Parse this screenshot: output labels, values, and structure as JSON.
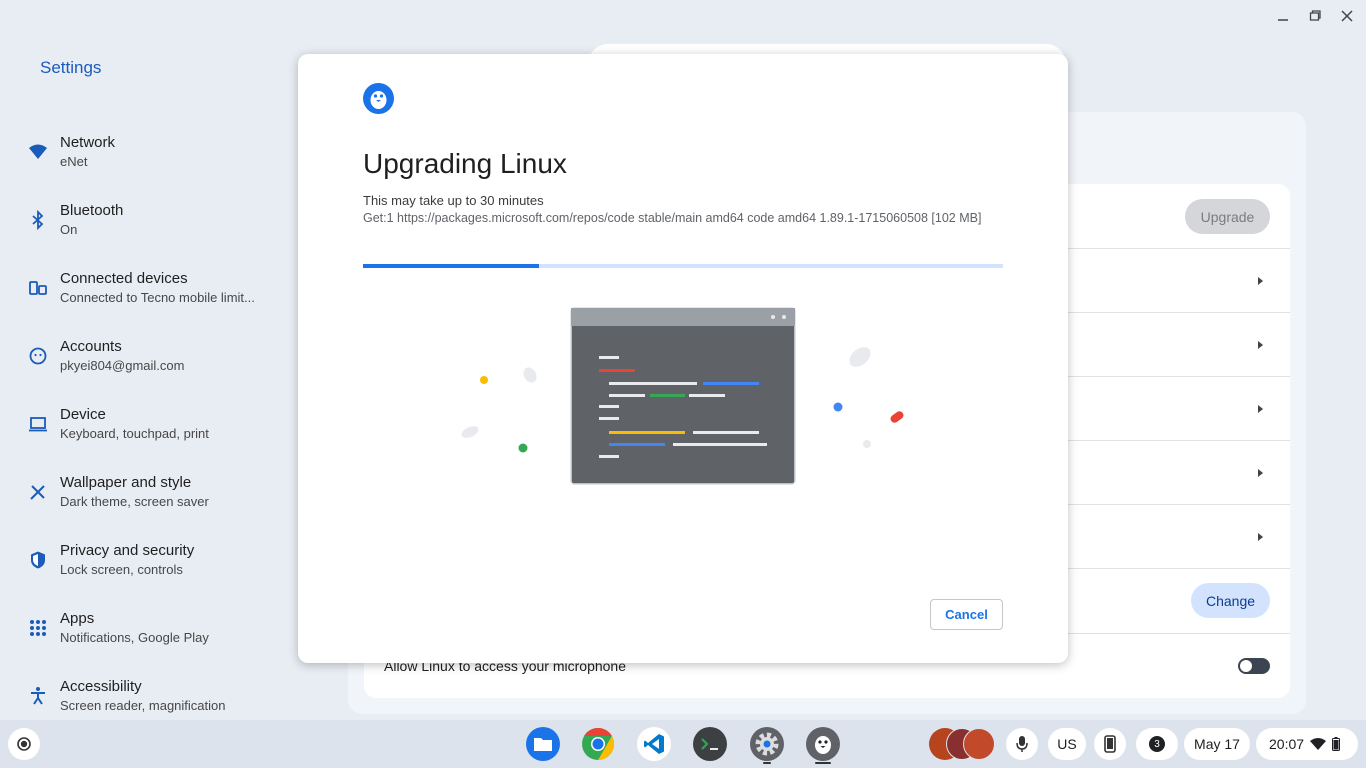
{
  "window": {
    "controls": [
      "minimize-icon",
      "restore-icon",
      "close-icon"
    ]
  },
  "settings": {
    "title": "Settings",
    "nav": [
      {
        "label": "Network",
        "sub": "eNet",
        "icon": "wifi-icon"
      },
      {
        "label": "Bluetooth",
        "sub": "On",
        "icon": "bluetooth-icon"
      },
      {
        "label": "Connected devices",
        "sub": "Connected to Tecno mobile limit...",
        "icon": "connected-devices-icon"
      },
      {
        "label": "Accounts",
        "sub": "pkyei804@gmail.com",
        "icon": "account-icon"
      },
      {
        "label": "Device",
        "sub": "Keyboard, touchpad, print",
        "icon": "laptop-icon"
      },
      {
        "label": "Wallpaper and style",
        "sub": "Dark theme, screen saver",
        "icon": "brush-icon"
      },
      {
        "label": "Privacy and security",
        "sub": "Lock screen, controls",
        "icon": "shield-icon"
      },
      {
        "label": "Apps",
        "sub": "Notifications, Google Play",
        "icon": "apps-grid-icon"
      },
      {
        "label": "Accessibility",
        "sub": "Screen reader, magnification",
        "icon": "accessibility-icon"
      }
    ]
  },
  "main": {
    "upgrade_label": "Upgrade",
    "change_label": "Change",
    "microphone_label": "Allow Linux to access your microphone",
    "microphone_enabled": false
  },
  "dialog": {
    "title": "Upgrading Linux",
    "subtitle": "This may take up to 30 minutes",
    "status": "Get:1 https://packages.microsoft.com/repos/code stable/main amd64 code amd64 1.89.1-1715060508 [102 MB]",
    "progress": 0.275,
    "cancel_label": "Cancel"
  },
  "shelf": {
    "apps": [
      "files-icon",
      "chrome-icon",
      "vscode-icon",
      "terminal-icon",
      "settings-icon",
      "linux-penguin-icon"
    ],
    "input_method": "US",
    "notification_count": "3",
    "date": "May 17",
    "time": "20:07"
  },
  "colors": {
    "accent": "#1a73e8",
    "link": "#1b5bb9",
    "background": "#e8edf4"
  }
}
